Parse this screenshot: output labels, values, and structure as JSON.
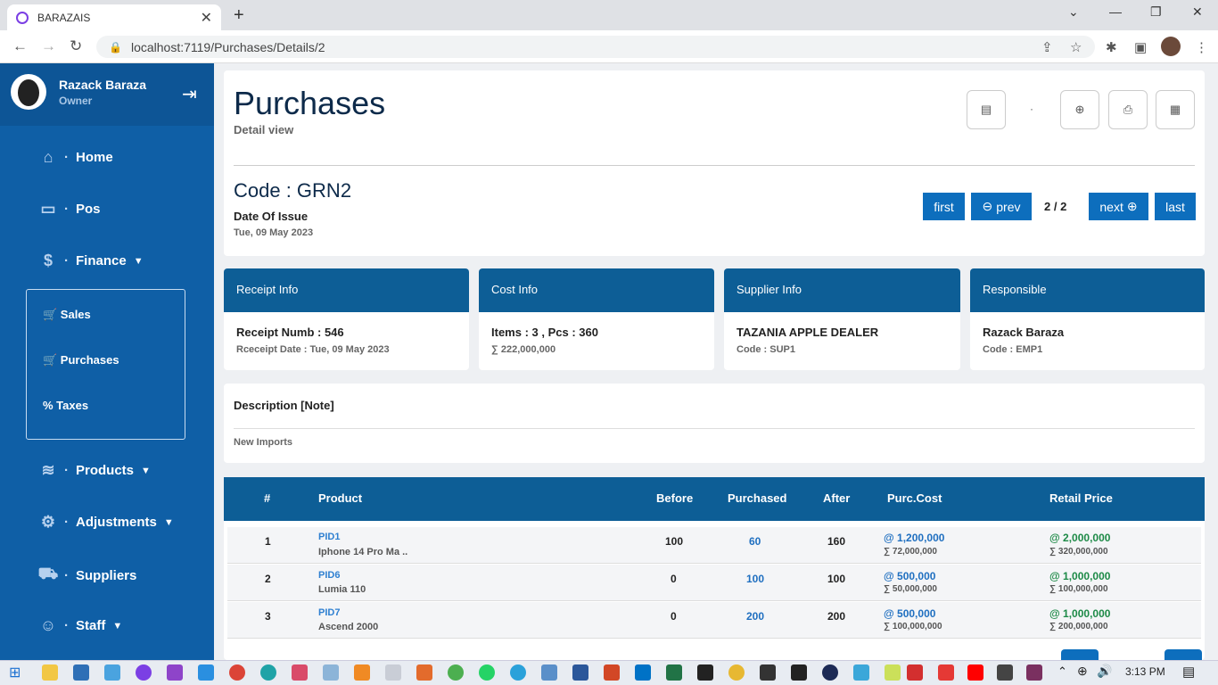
{
  "browser": {
    "tab_title": "BARAZAIS",
    "url": "localhost:7119/Purchases/Details/2"
  },
  "sidebar": {
    "user_name": "Razack  Baraza",
    "user_role": "Owner",
    "items": [
      {
        "label": "Home",
        "icon": "home-icon"
      },
      {
        "label": "Pos",
        "icon": "monitor-icon"
      },
      {
        "label": "Finance",
        "icon": "finance-icon"
      },
      {
        "label": "Products",
        "icon": "layers-icon"
      },
      {
        "label": "Adjustments",
        "icon": "adjust-icon"
      },
      {
        "label": "Suppliers",
        "icon": "truck-icon"
      },
      {
        "label": "Staff",
        "icon": "users-icon"
      }
    ],
    "finance_sub": [
      {
        "label": "🛒 Sales"
      },
      {
        "label": "🛒 Purchases"
      },
      {
        "label": "% Taxes"
      }
    ]
  },
  "header": {
    "title": "Purchases",
    "subtitle": "Detail view",
    "code": "Code : GRN2",
    "date_label": "Date Of Issue",
    "date_value": "Tue, 09 May 2023"
  },
  "pager": {
    "first": "first",
    "prev": "prev",
    "page": "2 / 2",
    "next": "next",
    "last": "last"
  },
  "info_cards": [
    {
      "title": "Receipt Info",
      "line1": "Receipt Numb : 546",
      "line2": "Rceceipt Date : Tue, 09 May 2023"
    },
    {
      "title": "Cost Info",
      "line1": "Items : 3 , Pcs : 360",
      "line2": "∑ 222,000,000"
    },
    {
      "title": "Supplier Info",
      "line1": "TAZANIA APPLE DEALER",
      "line2": "Code : SUP1"
    },
    {
      "title": "Responsible",
      "line1": "Razack Baraza",
      "line2": "Code : EMP1"
    }
  ],
  "description": {
    "title": "Description [Note]",
    "value": "New Imports"
  },
  "table": {
    "headers": [
      "#",
      "Product",
      "Before",
      "Purchased",
      "After",
      "Purc.Cost",
      "Retail Price"
    ],
    "rows": [
      {
        "no": "1",
        "pid": "PID1",
        "name": "Iphone 14 Pro Ma ..",
        "before": "100",
        "purchased": "60",
        "after": "160",
        "cost": "@ 1,200,000",
        "cost_total": "∑ 72,000,000",
        "retail": "@ 2,000,000",
        "retail_total": "∑ 320,000,000"
      },
      {
        "no": "2",
        "pid": "PID6",
        "name": "Lumia 110",
        "before": "0",
        "purchased": "100",
        "after": "100",
        "cost": "@ 500,000",
        "cost_total": "∑ 50,000,000",
        "retail": "@ 1,000,000",
        "retail_total": "∑ 100,000,000"
      },
      {
        "no": "3",
        "pid": "PID7",
        "name": "Ascend 2000",
        "before": "0",
        "purchased": "200",
        "after": "200",
        "cost": "@ 500,000",
        "cost_total": "∑ 100,000,000",
        "retail": "@ 1,000,000",
        "retail_total": "∑ 200,000,000"
      }
    ]
  },
  "taskbar": {
    "time": "3:13 PM"
  },
  "colors": {
    "sidebar": "#0f5fa6",
    "header_blue": "#0d5e96",
    "button_blue": "#0d6ebd",
    "link_blue": "#1f6fc0",
    "green": "#1d8a47"
  }
}
